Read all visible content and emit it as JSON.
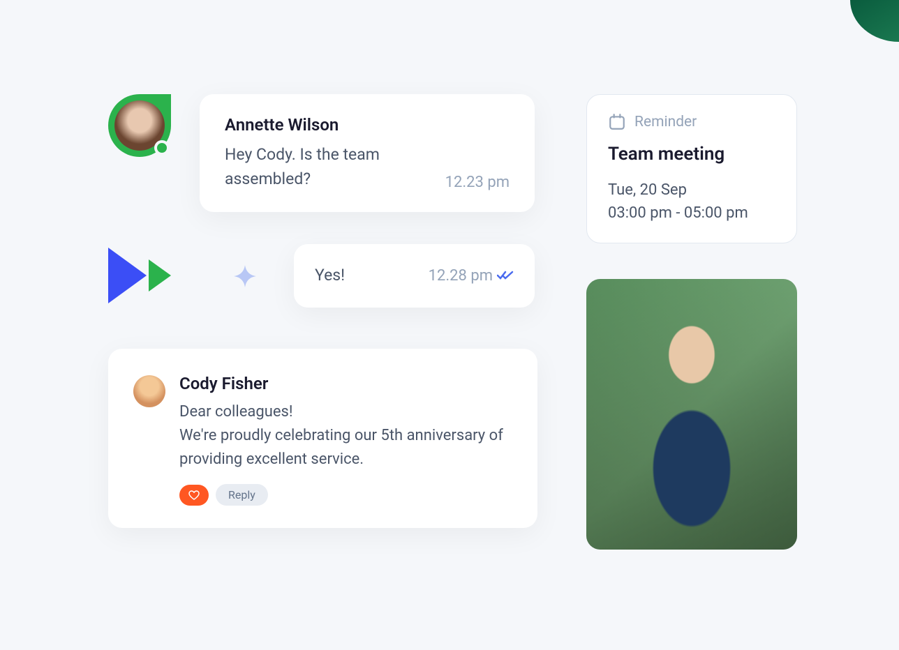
{
  "chat1": {
    "name": "Annette Wilson",
    "text": "Hey Cody. Is the team assembled?",
    "time": "12.23 pm"
  },
  "chat2": {
    "text": "Yes!",
    "time": "12.28 pm"
  },
  "post": {
    "name": "Cody Fisher",
    "text": "Dear colleagues!\nWe're proudly celebrating our 5th anniversary of providing excellent service.",
    "reply_label": "Reply"
  },
  "reminder": {
    "label": "Reminder",
    "title": "Team meeting",
    "date": "Tue, 20 Sep",
    "time": "03:00 pm - 05:00 pm"
  },
  "colors": {
    "green": "#2bb24c",
    "blue": "#3b4ef6",
    "orange": "#ff5722",
    "purple": "#9fb4ff"
  }
}
